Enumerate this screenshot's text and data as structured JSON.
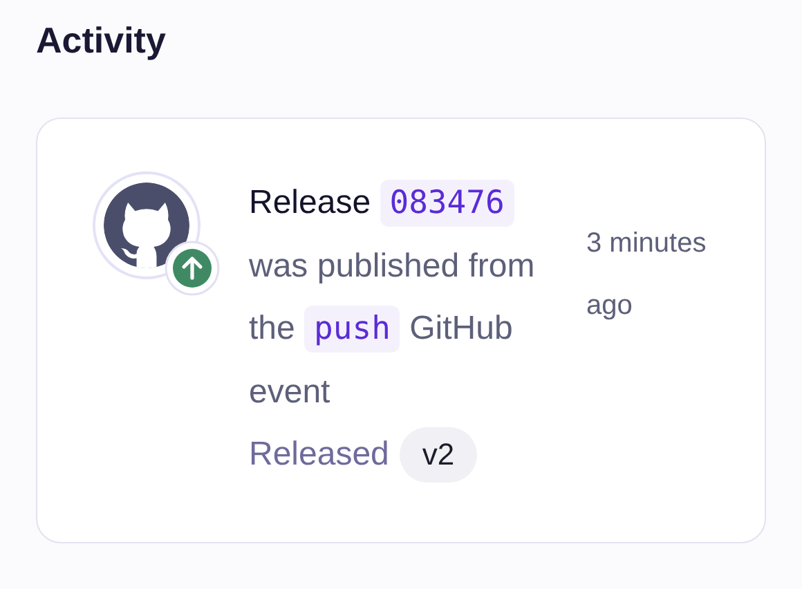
{
  "heading": "Activity",
  "event": {
    "title": "Release",
    "release_id": "083476",
    "text_1": "was published from the",
    "event_name": "push",
    "text_2": "GitHub event",
    "status": "Released",
    "version": "v2",
    "time": "3 minutes ago"
  }
}
